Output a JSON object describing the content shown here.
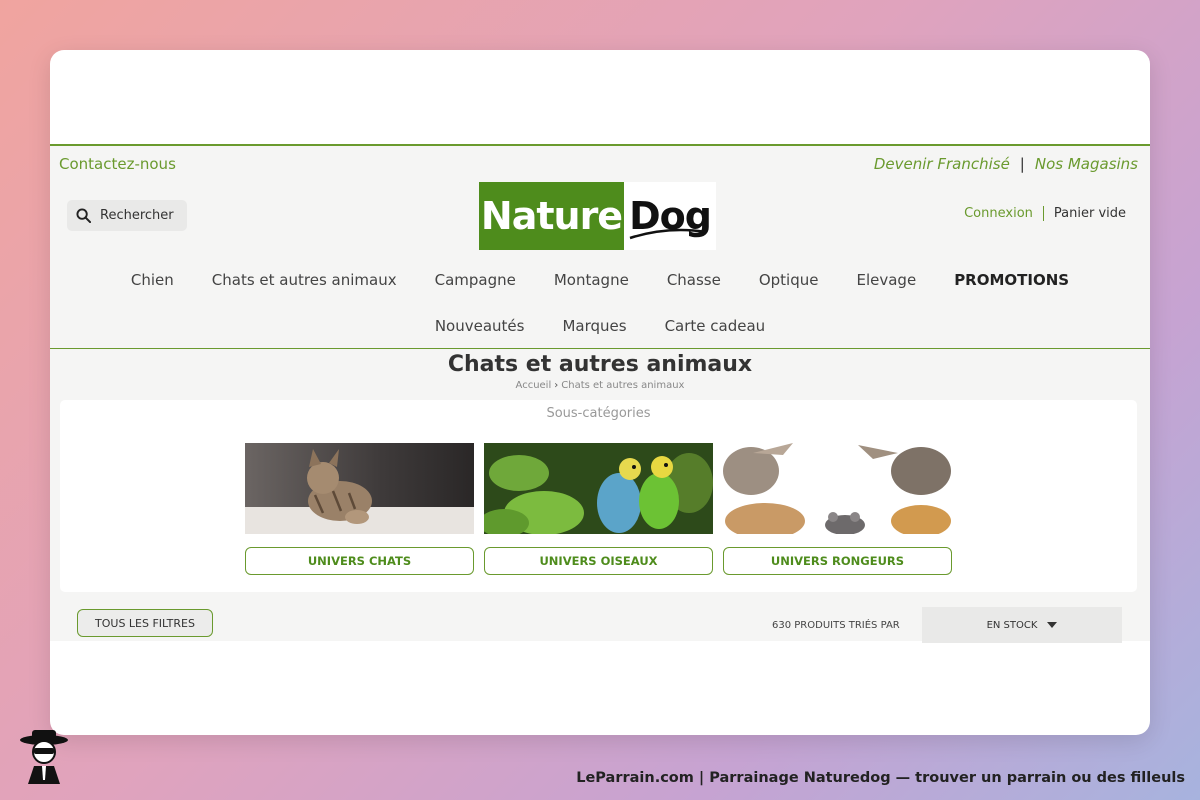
{
  "topbar": {
    "contact": "Contactez-nous",
    "franchise": "Devenir Franchisé",
    "separator": "|",
    "stores": "Nos Magasins"
  },
  "header": {
    "search_label": "Rechercher",
    "logo_part1": "Nature",
    "logo_part2": "Dog",
    "login": "Connexion",
    "cart": "Panier vide"
  },
  "nav": {
    "row1": [
      "Chien",
      "Chats et autres animaux",
      "Campagne",
      "Montagne",
      "Chasse",
      "Optique",
      "Elevage",
      "PROMOTIONS"
    ],
    "row2": [
      "Nouveautés",
      "Marques",
      "Carte cadeau"
    ]
  },
  "page": {
    "title": "Chats et autres animaux",
    "breadcrumb_home": "Accueil",
    "breadcrumb_current": "Chats et autres animaux"
  },
  "subcategories": {
    "title": "Sous-catégories",
    "items": [
      {
        "label": "UNIVERS CHATS"
      },
      {
        "label": "UNIVERS OISEAUX"
      },
      {
        "label": "UNIVERS RONGEURS"
      }
    ]
  },
  "listing": {
    "filters_button": "TOUS LES FILTRES",
    "count_text": "630 PRODUITS TRIÉS PAR",
    "sort_value": "EN STOCK"
  },
  "footer": {
    "caption": "LeParrain.com | Parrainage Naturedog — trouver un parrain ou des filleuls"
  },
  "colors": {
    "brand_green": "#4e8c1c",
    "accent_green": "#6a9a2e"
  }
}
